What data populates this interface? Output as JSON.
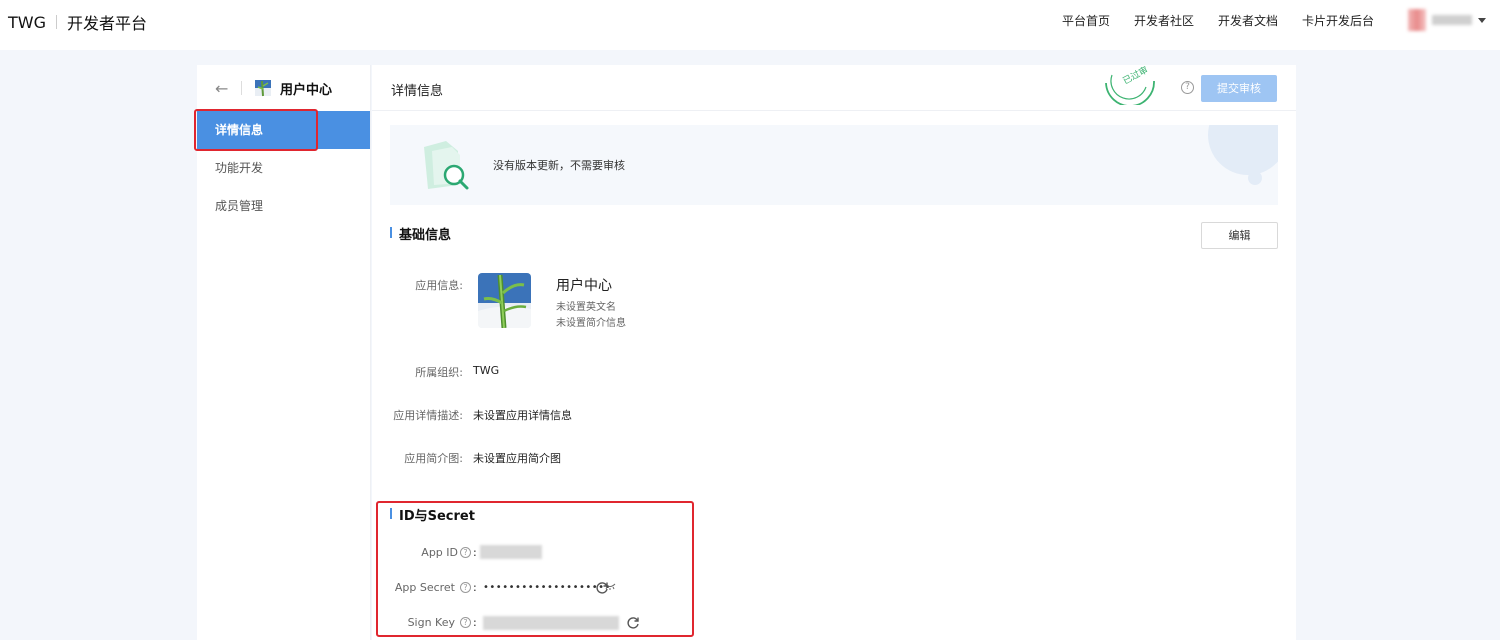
{
  "header": {
    "brand": "TWG",
    "platform": "开发者平台",
    "nav": [
      "平台首页",
      "开发者社区",
      "开发者文档",
      "卡片开发后台"
    ]
  },
  "sidebar": {
    "title": "用户中心",
    "items": [
      {
        "label": "详情信息",
        "active": true
      },
      {
        "label": "功能开发",
        "active": false
      },
      {
        "label": "成员管理",
        "active": false
      }
    ]
  },
  "main": {
    "title": "详情信息",
    "stamp_text": "已过审",
    "submit_label": "提交审核",
    "notice": "没有版本更新，不需要审核",
    "basic": {
      "section_title": "基础信息",
      "edit_label": "编辑",
      "app_info_label": "应用信息:",
      "app_name": "用户中心",
      "english_name": "未设置英文名",
      "brief": "未设置简介信息",
      "org_label": "所属组织:",
      "org_value": "TWG",
      "desc_label": "应用详情描述:",
      "desc_value": "未设置应用详情信息",
      "image_label": "应用简介图:",
      "image_value": "未设置应用简介图"
    },
    "secret": {
      "section_title": "ID与Secret",
      "app_id_label": "App ID",
      "app_secret_label": "App Secret",
      "app_secret_value": "••••••••••••••••••••",
      "sign_key_label": "Sign Key"
    }
  },
  "colors": {
    "accent": "#4a90e2",
    "submit_disabled": "#9ec5f3",
    "highlight_red": "#e0262f",
    "stamp_green": "#3cb371",
    "page_bg": "#f3f6fb"
  }
}
